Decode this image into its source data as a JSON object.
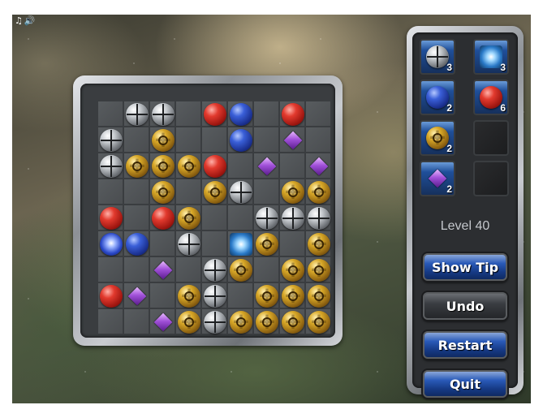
{
  "level": {
    "label": "Level 40"
  },
  "buttons": {
    "show_tip": "Show Tip",
    "undo": "Undo",
    "restart": "Restart",
    "quit": "Quit"
  },
  "inventory": [
    {
      "piece": "silver",
      "count": "3"
    },
    {
      "piece": "star",
      "count": "3"
    },
    {
      "piece": "blue",
      "count": "2"
    },
    {
      "piece": "red",
      "count": "6"
    },
    {
      "piece": "gold",
      "count": "2"
    },
    {
      "piece": "empty",
      "count": ""
    },
    {
      "piece": "gem",
      "count": "2"
    },
    {
      "piece": "empty",
      "count": ""
    }
  ],
  "board": [
    [
      "",
      "silver",
      "silver",
      "",
      "red",
      "blue",
      "",
      "red",
      ""
    ],
    [
      "silver",
      "",
      "gold",
      "",
      "",
      "blue",
      "",
      "gem",
      ""
    ],
    [
      "silver",
      "gold",
      "gold",
      "gold",
      "red",
      "",
      "gem",
      "",
      "gem"
    ],
    [
      "",
      "",
      "gold",
      "",
      "gold",
      "silver",
      "",
      "gold",
      "gold"
    ],
    [
      "red",
      "",
      "red",
      "gold",
      "",
      "",
      "silver",
      "silver",
      "silver"
    ],
    [
      "bluestar",
      "blue",
      "",
      "silver",
      "",
      "star",
      "gold",
      "",
      "gold"
    ],
    [
      "",
      "",
      "gem",
      "",
      "silver",
      "gold",
      "",
      "gold",
      "gold"
    ],
    [
      "red",
      "gem",
      "",
      "gold",
      "silver",
      "",
      "gold",
      "gold",
      "gold"
    ],
    [
      "",
      "",
      "gem",
      "gold",
      "silver",
      "gold",
      "gold",
      "gold",
      "gold"
    ]
  ],
  "icons": {
    "music": "music-note-icon",
    "sound": "speaker-icon"
  }
}
